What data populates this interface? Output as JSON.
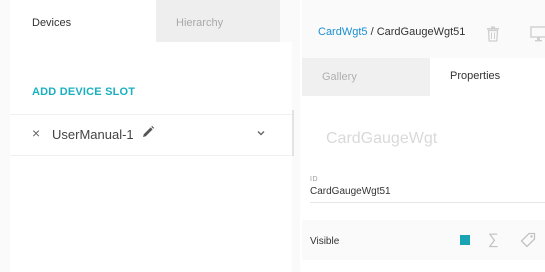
{
  "left": {
    "tabs": [
      {
        "label": "Devices"
      },
      {
        "label": "Hierarchy"
      }
    ],
    "add_slot_label": "ADD DEVICE SLOT",
    "device": {
      "remove_glyph": "×",
      "name": "UserManual-1",
      "edit_icon": "pencil-icon",
      "expand_icon": "chevron-down-icon"
    }
  },
  "right": {
    "breadcrumb": {
      "parent": "CardWgt5",
      "separator": " / ",
      "current": "CardGaugeWgt51"
    },
    "header_icons": [
      "trash-icon",
      "monitor-icon"
    ],
    "tabs": [
      {
        "label": "Gallery"
      },
      {
        "label": "Properties"
      }
    ],
    "widget_title": "CardGaugeWgt",
    "id_field": {
      "label": "ID",
      "value": "CardGaugeWgt51"
    },
    "visible": {
      "label": "Visible",
      "checked": true,
      "icons": [
        "sigma-icon",
        "tag-icon"
      ]
    }
  },
  "colors": {
    "accent": "#1ab0bf",
    "link": "#1a8fd1",
    "checkbox": "#1aa3b5",
    "badge": "#f7a8a8"
  }
}
